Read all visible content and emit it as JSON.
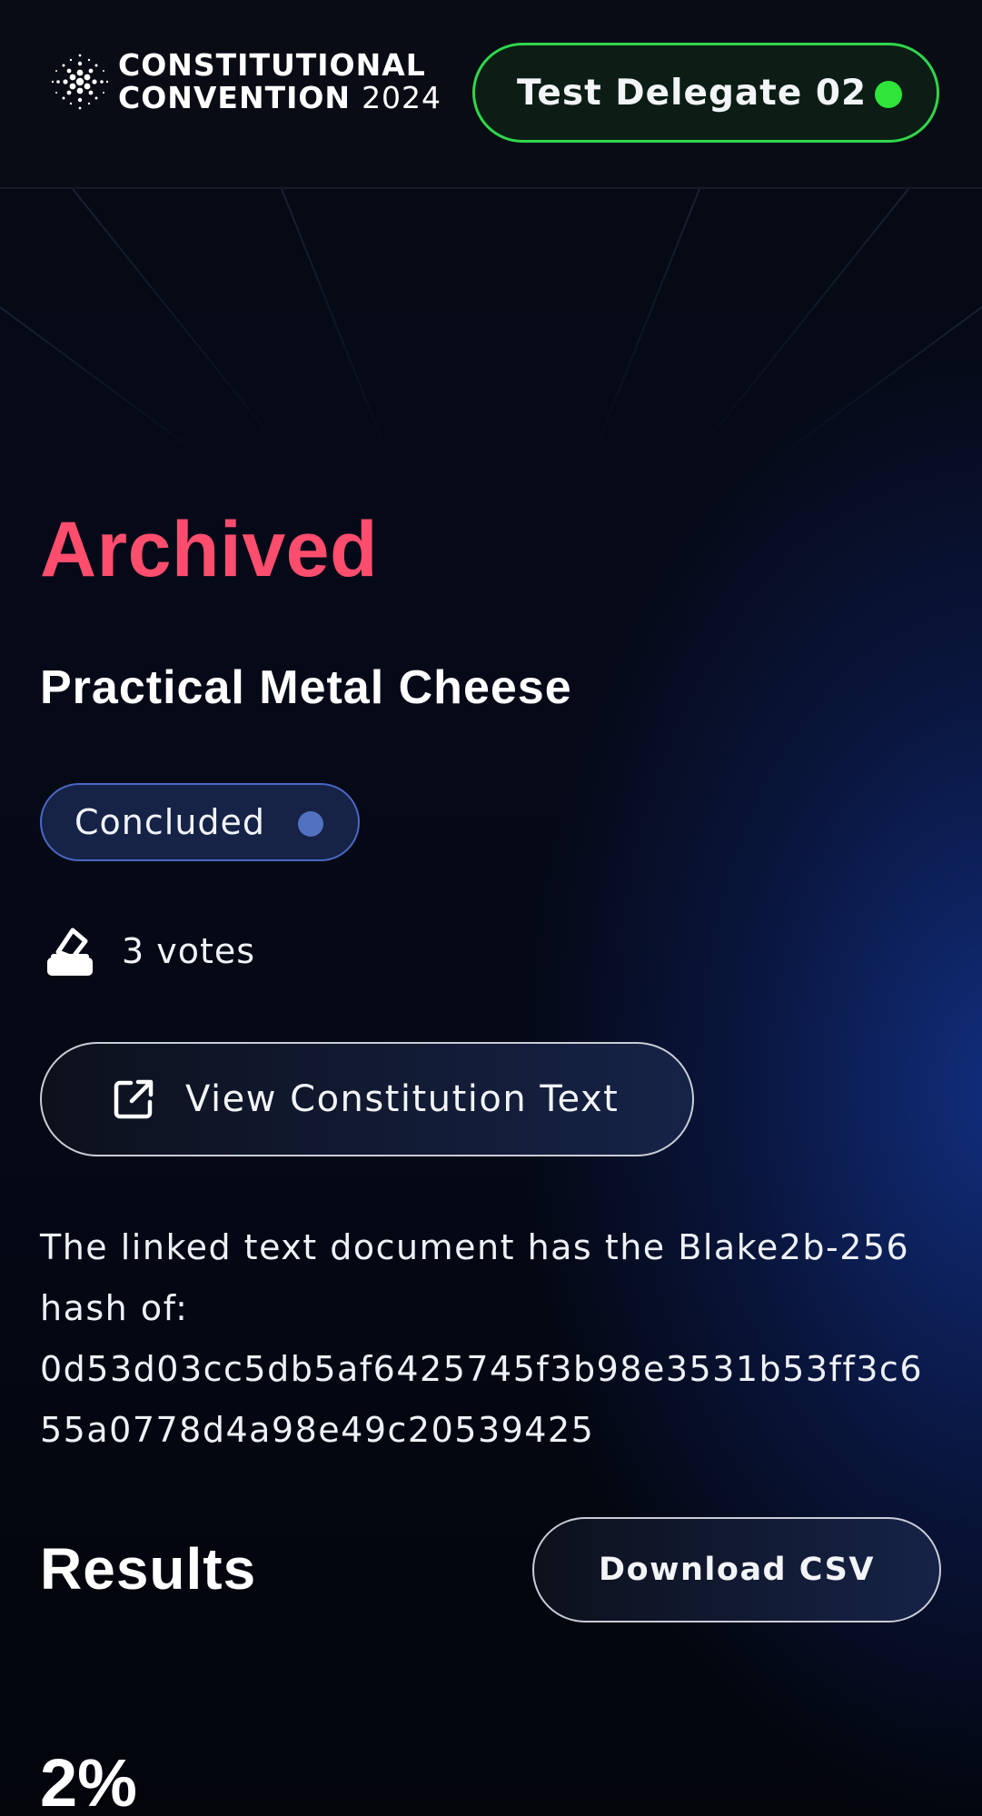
{
  "header": {
    "logo_line1": "CONSTITUTIONAL",
    "logo_line2": "CONVENTION",
    "logo_year": "2024",
    "logo_icon": "cardano-dots-icon",
    "delegate_name": "Test Delegate 02",
    "delegate_status_color": "#2ee53a"
  },
  "proposal": {
    "state": "Archived",
    "state_color": "#ff4d6d",
    "title": "Practical Metal Cheese",
    "status_badge": "Concluded",
    "votes": "3 votes",
    "vote_icon": "ballot-box-icon",
    "view_button": "View Constitution Text",
    "view_button_icon": "external-link-icon",
    "hash_intro": "The linked text document has the Blake2b-256 hash of:",
    "hash_value": "0d53d03cc5db5af6425745f3b98e3531b53ff3c655a0778d4a98e49c20539425"
  },
  "results": {
    "title": "Results",
    "download_button": "Download CSV",
    "first_percent": "2%"
  }
}
